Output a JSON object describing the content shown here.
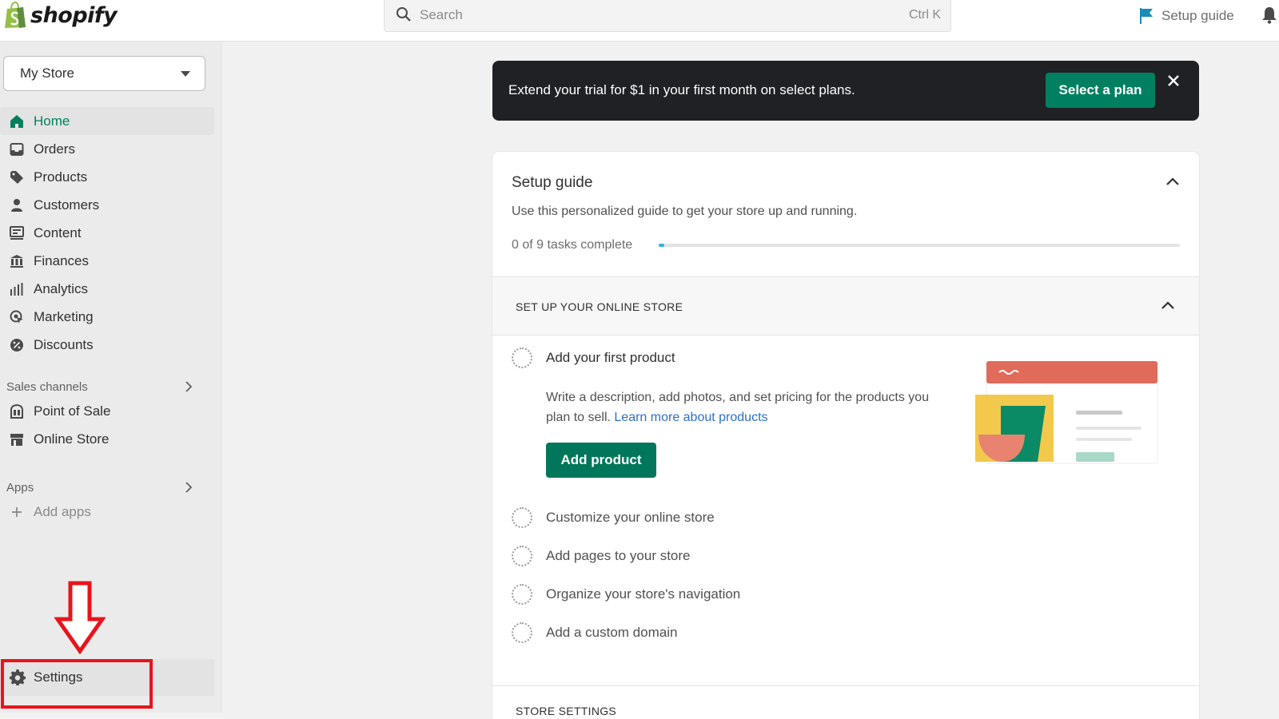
{
  "topbar": {
    "logo_text": "shopify",
    "search_placeholder": "Search",
    "search_shortcut": "Ctrl K",
    "setup_guide_label": "Setup guide"
  },
  "sidebar": {
    "store_name": "My Store",
    "nav_items": [
      {
        "label": "Home",
        "icon": "home-icon",
        "active": true
      },
      {
        "label": "Orders",
        "icon": "orders-icon"
      },
      {
        "label": "Products",
        "icon": "tag-icon"
      },
      {
        "label": "Customers",
        "icon": "person-icon"
      },
      {
        "label": "Content",
        "icon": "content-icon"
      },
      {
        "label": "Finances",
        "icon": "bank-icon"
      },
      {
        "label": "Analytics",
        "icon": "bar-chart-icon"
      },
      {
        "label": "Marketing",
        "icon": "target-icon"
      },
      {
        "label": "Discounts",
        "icon": "discount-icon"
      }
    ],
    "sales_channels_label": "Sales channels",
    "sales_channels": [
      {
        "label": "Point of Sale",
        "icon": "pos-icon"
      },
      {
        "label": "Online Store",
        "icon": "storefront-icon"
      }
    ],
    "apps_label": "Apps",
    "add_apps_label": "Add apps",
    "settings_label": "Settings"
  },
  "banner": {
    "message": "Extend your trial for $1 in your first month on select plans.",
    "button_label": "Select a plan"
  },
  "setup_guide": {
    "title": "Setup guide",
    "subtitle": "Use this personalized guide to get your store up and running.",
    "progress_text": "0 of 9 tasks complete",
    "progress_fraction": 0.01,
    "section_label": "SET UP YOUR ONLINE STORE",
    "tasks": [
      {
        "label": "Add your first product"
      },
      {
        "label": "Customize your online store"
      },
      {
        "label": "Add pages to your store"
      },
      {
        "label": "Organize your store's navigation"
      },
      {
        "label": "Add a custom domain"
      }
    ],
    "task_description": "Write a description, add photos, and set pricing for the products you plan to sell.",
    "learn_more_label": "Learn more about products",
    "add_product_label": "Add product",
    "next_section_label": "STORE SETTINGS"
  },
  "colors": {
    "accent_green": "#008060",
    "banner_bg": "#1f2124",
    "highlight_red": "#e8141c",
    "progress_blue": "#29b3e3"
  }
}
